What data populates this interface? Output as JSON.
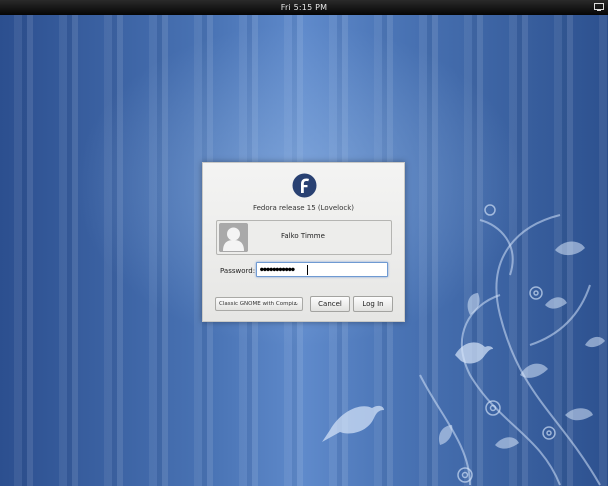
{
  "top_panel": {
    "clock": "Fri  5:15 PM",
    "tray_icon": "accessibility-icon"
  },
  "dialog": {
    "logo": "fedora-logo-icon",
    "release": "Fedora release 15 (Lovelock)",
    "user": {
      "name": "Falko Timme",
      "avatar": "user-avatar-icon"
    },
    "password_label": "Password:",
    "password_value": "●●●●●●●●●●●",
    "session_value": "Classic GNOME with Compiz",
    "session_arrow": "⌄",
    "cancel_label": "Cancel",
    "login_label": "Log In"
  },
  "colors": {
    "desktop_blue": "#3a5f9c",
    "panel_black": "#050505",
    "focus_blue": "#6f9ad2",
    "fedora_blue": "#294172"
  }
}
